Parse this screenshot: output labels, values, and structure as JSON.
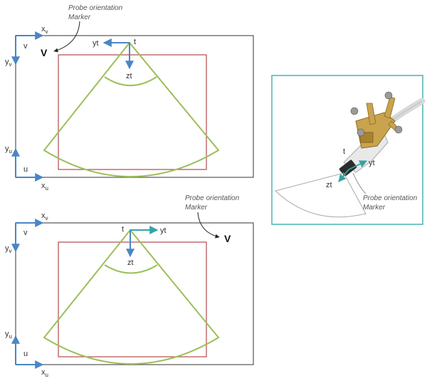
{
  "colors": {
    "frame": "#555555",
    "roi": "#b24a4a",
    "fan": "#9bbf5a",
    "axis_blue": "#4a86c5",
    "axis_teal": "#33a3a3",
    "photo_border": "#46b3b5"
  },
  "top_panel": {
    "marker_caption_line1": "Probe orientation",
    "marker_caption_line2": "Marker",
    "marker_letter": "V",
    "x_v": "x",
    "x_v_sub": "v",
    "v": "v",
    "y_v": "y",
    "y_v_sub": "v",
    "y_u": "y",
    "y_u_sub": "u",
    "u": "u",
    "x_u": "x",
    "x_u_sub": "u",
    "t": "t",
    "yt": "yt",
    "zt": "zt"
  },
  "bottom_panel": {
    "marker_caption_line1": "Probe orientation",
    "marker_caption_line2": "Marker",
    "marker_letter": "V",
    "x_v": "x",
    "x_v_sub": "v",
    "v": "v",
    "y_v": "y",
    "y_v_sub": "v",
    "y_u": "y",
    "y_u_sub": "u",
    "u": "u",
    "x_u": "x",
    "x_u_sub": "u",
    "t": "t",
    "yt": "yt",
    "zt": "zt"
  },
  "photo_panel": {
    "t": "t",
    "yt": "yt",
    "zt": "zt",
    "marker_caption_line1": "Probe orientation",
    "marker_caption_line2": "Marker"
  }
}
